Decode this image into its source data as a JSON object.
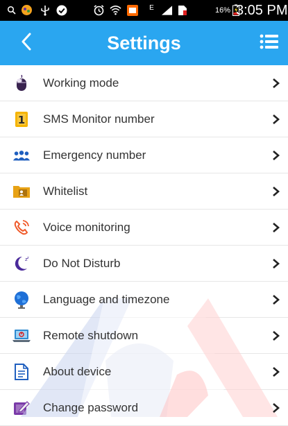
{
  "status_bar": {
    "battery_percent": "16%",
    "time": "3:05 PM",
    "network_type": "E"
  },
  "header": {
    "title": "Settings",
    "back_icon": "chevron-left-icon",
    "menu_icon": "list-menu-icon"
  },
  "settings_items": [
    {
      "label": "Working mode",
      "icon": "mouse-icon"
    },
    {
      "label": "SMS Monitor number",
      "icon": "sim-number-icon"
    },
    {
      "label": "Emergency number",
      "icon": "contacts-group-icon"
    },
    {
      "label": "Whitelist",
      "icon": "folder-contact-icon"
    },
    {
      "label": "Voice monitoring",
      "icon": "phone-ring-icon"
    },
    {
      "label": "Do Not Disturb",
      "icon": "moon-sleep-icon"
    },
    {
      "label": "Language and timezone",
      "icon": "globe-icon"
    },
    {
      "label": "Remote shutdown",
      "icon": "laptop-power-icon"
    },
    {
      "label": "About device",
      "icon": "document-icon"
    },
    {
      "label": "Change password",
      "icon": "edit-icon"
    }
  ],
  "colors": {
    "app_bar": "#2aa6f0",
    "status_bar": "#000000",
    "text": "#333333",
    "divider": "#e6e6e6"
  }
}
